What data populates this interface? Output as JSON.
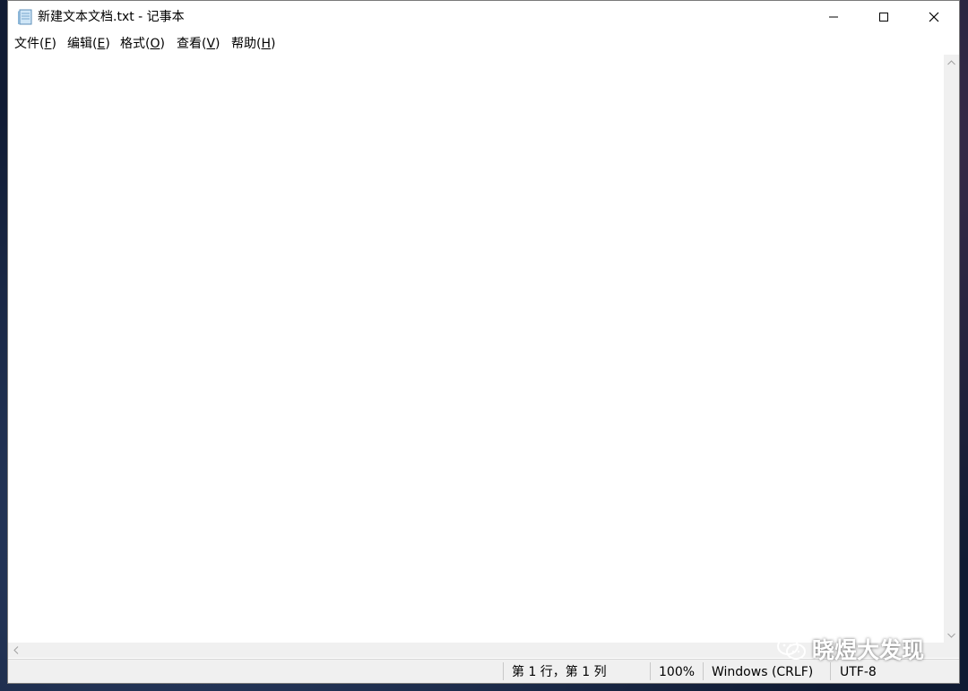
{
  "window": {
    "title": "新建文本文档.txt - 记事本",
    "app_icon": "notepad-icon"
  },
  "titlebar": {
    "minimize_icon": "minimize-icon",
    "maximize_icon": "maximize-icon",
    "close_icon": "close-icon"
  },
  "menu": {
    "items": [
      {
        "label": "文件(",
        "accel": "F",
        "end": ")"
      },
      {
        "label": "编辑(",
        "accel": "E",
        "end": ")"
      },
      {
        "label": "格式(",
        "accel": "O",
        "end": ")"
      },
      {
        "label": "查看(",
        "accel": "V",
        "end": ")"
      },
      {
        "label": "帮助(",
        "accel": "H",
        "end": ")"
      }
    ]
  },
  "editor": {
    "content": ""
  },
  "statusbar": {
    "position": "第 1 行，第 1 列",
    "zoom": "100%",
    "line_ending": "Windows (CRLF)",
    "encoding": "UTF-8"
  },
  "watermark": {
    "text": "晓煜大发现",
    "icon": "wechat-icon"
  },
  "colors": {
    "window_bg": "#ffffff",
    "chrome_bg": "#f0f0f0",
    "text": "#000000"
  }
}
